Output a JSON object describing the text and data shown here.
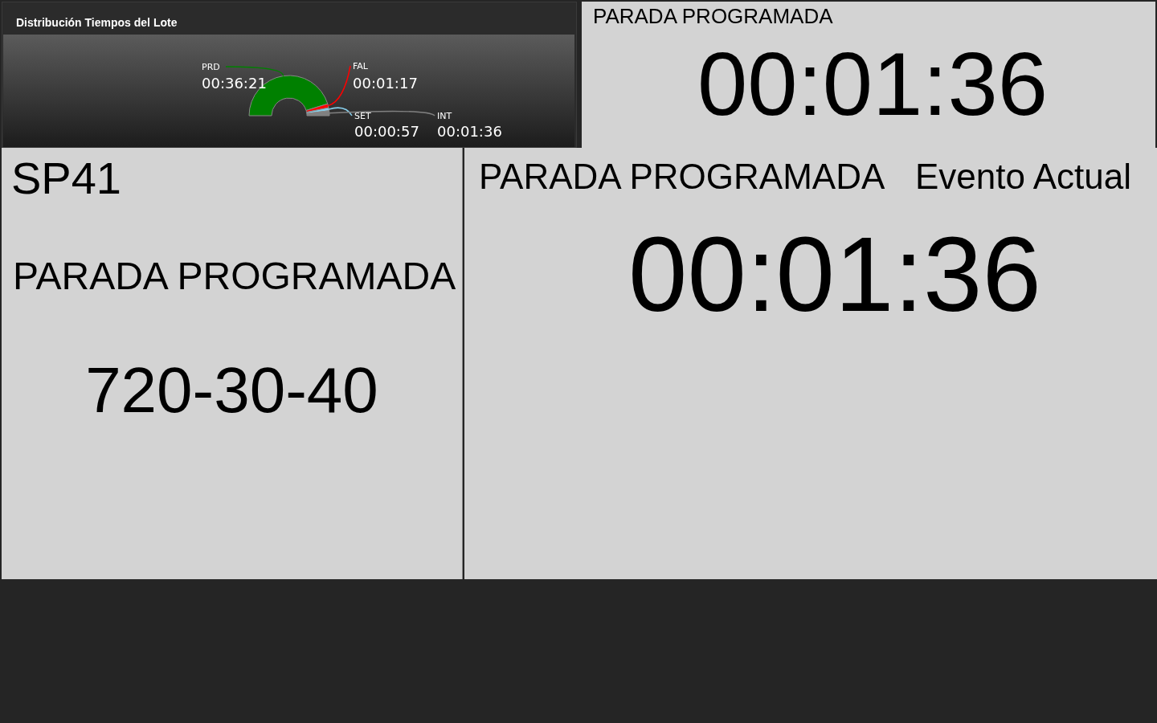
{
  "batch_chart": {
    "title": "Distribución Tiempos del Lote",
    "chart_data": {
      "type": "donut",
      "categories": [
        "PRD",
        "FAL",
        "SET",
        "INT"
      ],
      "values": [
        90.46,
        3.19,
        2.36,
        3.99
      ],
      "colors": [
        "#008000",
        "#ff0000",
        "#87ceeb",
        "#808080"
      ]
    },
    "slice_times": [
      "00:36:21",
      "00:01:17",
      "00:00:57",
      "00:01:36"
    ]
  },
  "current_stop": {
    "label": "PARADA PROGRAMADA",
    "time": "00:01:36"
  },
  "machine": {
    "code": "SP41",
    "state": "PARADA PROGRAMADA",
    "reference": "720-30-40"
  },
  "current_event": {
    "label": "PARADA PROGRAMADA",
    "caption": "Evento Actual",
    "time": "00:01:36"
  }
}
